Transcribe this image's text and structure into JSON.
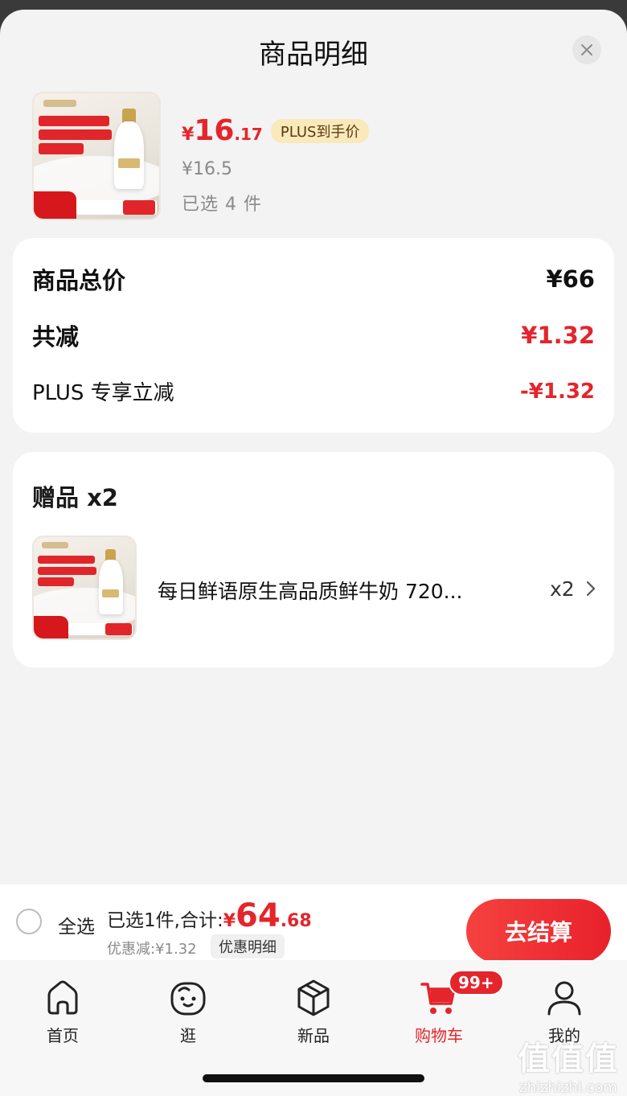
{
  "sheet": {
    "title": "商品明细",
    "close_icon": "close-icon"
  },
  "product": {
    "price_currency": "¥",
    "price_int": "16",
    "price_dec": ".17",
    "plus_tag": "PLUS到手价",
    "original_price": "¥16.5",
    "selected_count": "已选 4 件"
  },
  "price_card": {
    "rows": [
      {
        "label": "商品总价",
        "value": "¥66"
      },
      {
        "label": "共减",
        "value": "¥1.32"
      },
      {
        "label": "PLUS 专享立减",
        "value": "-¥1.32"
      }
    ]
  },
  "gift_card": {
    "title": "赠品 x2",
    "item_name": "每日鲜语原生高品质鲜牛奶 720...",
    "item_qty": "x2",
    "chevron_icon": "chevron-right-icon"
  },
  "bottom_bar": {
    "select_all": "全选",
    "summary_label": "已选1件,合计:",
    "total_currency": "¥",
    "total_int": "64",
    "total_dec": ".68",
    "discount_text": "优惠减:¥1.32",
    "detail_chip": "优惠明细",
    "checkout_label": "去结算"
  },
  "tabbar": {
    "tabs": [
      {
        "label": "首页",
        "icon": "home-icon"
      },
      {
        "label": "逛",
        "icon": "face-icon"
      },
      {
        "label": "新品",
        "icon": "box-icon"
      },
      {
        "label": "购物车",
        "icon": "cart-icon",
        "active": true,
        "badge": "99+"
      },
      {
        "label": "我的",
        "icon": "person-icon"
      }
    ]
  },
  "watermark": {
    "text_big": "值值值",
    "text_small": "zhizhizhi.com"
  },
  "colors": {
    "accent_red": "#e4252b",
    "plus_tag_bg": "#f9e9bb"
  }
}
